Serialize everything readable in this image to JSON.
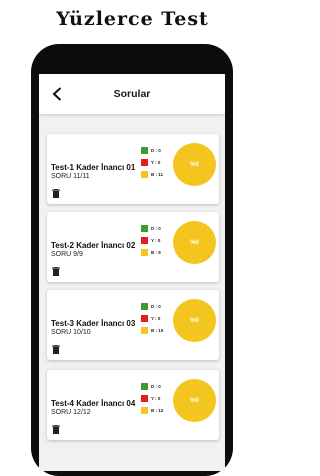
{
  "headline": "Yüzlerce Test",
  "appbar": {
    "title": "Sorular",
    "back_icon": "arrow-left-icon"
  },
  "colors": {
    "correct": "#3e9b2c",
    "wrong": "#e02020",
    "blank": "#f5c51f"
  },
  "tests": [
    {
      "title": "Test-1 Kader İnancı 01",
      "progress": "SORU 11/11",
      "correct": "D : 0",
      "wrong": "Y : 0",
      "blank": "B : 11",
      "percent": "%0"
    },
    {
      "title": "Test-2 Kader İnancı 02",
      "progress": "SORU 9/9",
      "correct": "D : 0",
      "wrong": "Y : 0",
      "blank": "B : 9",
      "percent": "%0"
    },
    {
      "title": "Test-3 Kader İnancı 03",
      "progress": "SORU 10/10",
      "correct": "D : 0",
      "wrong": "Y : 0",
      "blank": "B : 10",
      "percent": "%0"
    },
    {
      "title": "Test-4 Kader İnancı 04",
      "progress": "SORU 12/12",
      "correct": "D : 0",
      "wrong": "Y : 0",
      "blank": "B : 12",
      "percent": "%0"
    }
  ]
}
